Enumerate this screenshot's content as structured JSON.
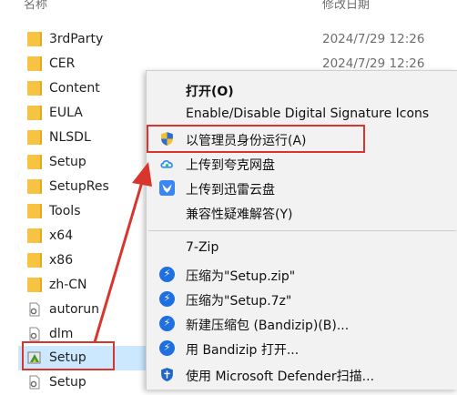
{
  "explorer": {
    "column_name": "名称",
    "column_date": "修改日期",
    "files": [
      {
        "name": "3rdParty",
        "date": "2024/7/29 12:26",
        "icon": "folder-icon"
      },
      {
        "name": "CER",
        "date": "2024/7/29 12:26",
        "icon": "folder-icon"
      },
      {
        "name": "Content",
        "date": "",
        "icon": "folder-icon"
      },
      {
        "name": "EULA",
        "date": "",
        "icon": "folder-icon"
      },
      {
        "name": "NLSDL",
        "date": "",
        "icon": "folder-icon"
      },
      {
        "name": "Setup",
        "date": "",
        "icon": "folder-icon"
      },
      {
        "name": "SetupRes",
        "date": "",
        "icon": "folder-icon"
      },
      {
        "name": "Tools",
        "date": "",
        "icon": "folder-icon"
      },
      {
        "name": "x64",
        "date": "",
        "icon": "folder-icon"
      },
      {
        "name": "x86",
        "date": "",
        "icon": "folder-icon"
      },
      {
        "name": "zh-CN",
        "date": "",
        "icon": "folder-icon"
      },
      {
        "name": "autorun",
        "date": "",
        "icon": "settings-file-icon"
      },
      {
        "name": "dlm",
        "date": "",
        "icon": "settings-file-icon"
      },
      {
        "name": "Setup",
        "date": "",
        "icon": "setup-exe-icon"
      },
      {
        "name": "Setup",
        "date": "",
        "icon": "settings-file-icon"
      }
    ]
  },
  "context_menu": {
    "items": [
      {
        "label": "打开(O)",
        "icon": ""
      },
      {
        "label": "Enable/Disable Digital Signature Icons",
        "icon": ""
      },
      {
        "label": "以管理员身份运行(A)",
        "icon": "uac-shield-icon"
      },
      {
        "label": "上传到夸克网盘",
        "icon": "quark-cloud-icon"
      },
      {
        "label": "上传到迅雷云盘",
        "icon": "xunlei-icon"
      },
      {
        "label": "兼容性疑难解答(Y)",
        "icon": ""
      },
      {
        "label": "7-Zip",
        "icon": ""
      },
      {
        "label": "压缩为\"Setup.zip\"",
        "icon": "bandizip-icon"
      },
      {
        "label": "压缩为\"Setup.7z\"",
        "icon": "bandizip-icon"
      },
      {
        "label": "新建压缩包 (Bandizip)(B)...",
        "icon": "bandizip-icon"
      },
      {
        "label": "用 Bandizip 打开...",
        "icon": "bandizip-icon"
      },
      {
        "label": "使用 Microsoft Defender扫描...",
        "icon": "defender-icon"
      }
    ]
  },
  "colors": {
    "annotation_red": "#d9352f",
    "selection_blue": "#cce8ff",
    "folder_yellow": "#f6c343",
    "bandizip_blue": "#1e6fe0"
  }
}
